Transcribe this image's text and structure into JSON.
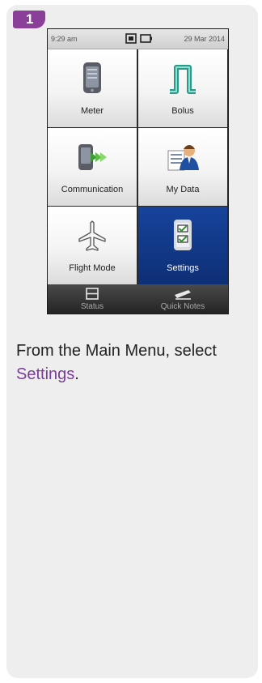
{
  "step": {
    "number": "1"
  },
  "device": {
    "status_bar": {
      "time": "9:29 am",
      "date": "29 Mar 2014"
    },
    "menu_items": [
      {
        "label": "Meter",
        "icon": "meter-icon",
        "selected": false
      },
      {
        "label": "Bolus",
        "icon": "bolus-icon",
        "selected": false
      },
      {
        "label": "Communication",
        "icon": "communication-icon",
        "selected": false
      },
      {
        "label": "My Data",
        "icon": "my-data-icon",
        "selected": false
      },
      {
        "label": "Flight Mode",
        "icon": "airplane-icon",
        "selected": false
      },
      {
        "label": "Settings",
        "icon": "settings-checklist-icon",
        "selected": true
      }
    ],
    "bottom_bar": [
      {
        "label": "Status",
        "icon": "status-icon"
      },
      {
        "label": "Quick Notes",
        "icon": "quick-notes-icon"
      }
    ]
  },
  "instruction": {
    "text": "From the Main Menu, select ",
    "highlight": "Settings",
    "suffix": "."
  },
  "colors": {
    "accent": "#7a3d99",
    "badge": "#8a3f98",
    "selected_tile": "#16439c",
    "card_background": "#eeeeee"
  }
}
